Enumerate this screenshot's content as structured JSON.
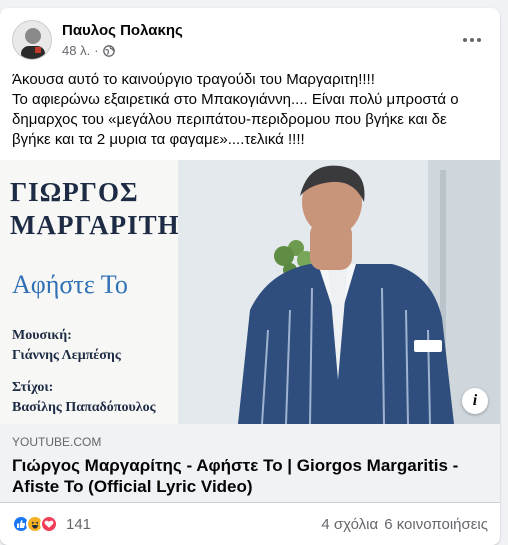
{
  "post": {
    "author": "Παυλος Πολακης",
    "time": "48 λ.",
    "visibility_icon": "globe-icon",
    "more_icon": "more-options-icon",
    "text": "Άκουσα αυτό το καινούργιο τραγούδι του Μαργαριτη!!!!\nΤο αφιερώνω εξαιρετικά στο Μπακογιάννη.... Είναι πολύ  μπροστά ο δημαρχος του «μεγάλου περιπάτου-περιδρομου που βγήκε και δε βγήκε και τα 2 μυρια τα φαγαμε»....τελικά !!!!"
  },
  "preview": {
    "artist_line1": "ΓΙΩΡΓΟΣ",
    "artist_line2": "ΜΑΡΓΑΡΙΤΗΣ",
    "song_title": "Αφήστε Το",
    "music_label": "Μουσική:",
    "music_value": "Γιάννης Λεμπέσης",
    "lyrics_label": "Στίχοι:",
    "lyrics_value": "Βασίλης Παπαδόπουλος",
    "info_icon": "info-icon",
    "info_glyph": "i"
  },
  "link": {
    "domain": "YOUTUBE.COM",
    "title": "Γιώργος Μαργαρίτης - Αφήστε Το | Giorgos Margaritis - Afiste To (Official Lyric Video)"
  },
  "footer": {
    "reaction_count": "141",
    "comments": "4 σχόλια",
    "shares": "6 κοινοποιήσεις",
    "reaction_icons": [
      "like-icon",
      "haha-icon",
      "love-icon"
    ],
    "colors": {
      "like": "#1877f2",
      "haha": "#f7b125",
      "love": "#f33e58"
    }
  }
}
